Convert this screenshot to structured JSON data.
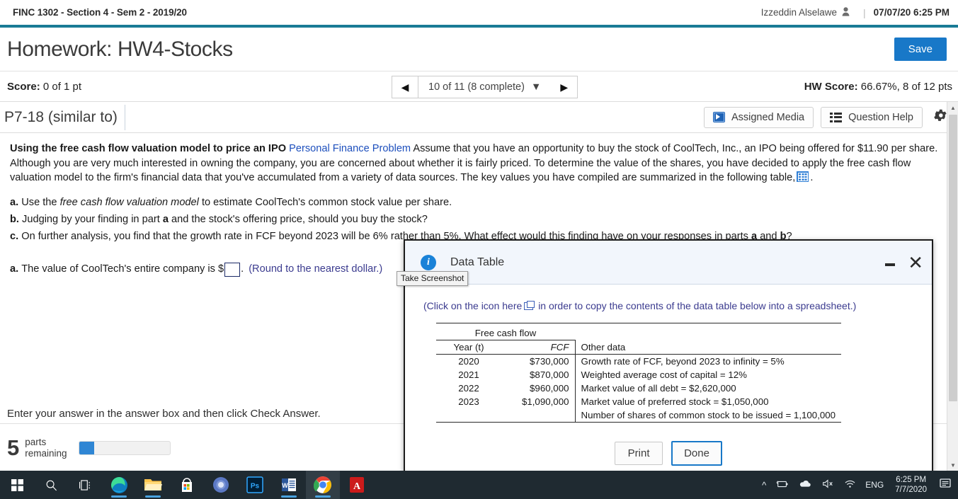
{
  "topbar": {
    "course": "FINC 1302 - Section 4 - Sem 2 - 2019/20",
    "user": "Izzeddin Alselawe",
    "separator": "|",
    "datetime": "07/07/20 6:25 PM",
    "person_icon": "person-icon"
  },
  "header": {
    "title": "Homework: HW4-Stocks",
    "save_label": "Save"
  },
  "scorebar": {
    "score_label": "Score:",
    "score_value": "0 of 1 pt",
    "prev_icon": "◀",
    "next_icon": "▶",
    "nav_label": "10 of 11 (8 complete)",
    "nav_caret": "▼",
    "hw_score_label": "HW Score:",
    "hw_score_value": "66.67%, 8 of 12 pts"
  },
  "exercise": {
    "id": "P7-18 (similar to)",
    "assigned_media": "Assigned Media",
    "question_help": "Question Help"
  },
  "question": {
    "bold_lead": "Using the free cash flow valuation model to price an IPO",
    "link": "Personal Finance Problem",
    "para": "Assume that you have an opportunity to buy the stock of CoolTech, Inc., an IPO being offered for $11.90 per share. Although you are very much interested in owning the company, you are concerned about whether it is fairly priced.  To determine the value of the shares, you have decided to apply the free cash flow valuation model to the firm's financial data that you've accumulated from a variety of data sources.  The key values you have compiled are summarized in the following table,",
    "para_end": ".",
    "parts": [
      {
        "label": "a.",
        "pre": "Use the ",
        "italic": "free cash flow valuation model",
        "post": " to estimate CoolTech's common stock value per share."
      },
      {
        "label": "b.",
        "pre": "Judging by your finding in part ",
        "italic": "",
        "post": "a and the stock's offering price, should you buy the stock?"
      },
      {
        "label": "c.",
        "pre": "On further analysis, you find that the growth rate in FCF beyond 2023 will be 6% rather than 5%. What effect would this finding have on your responses in parts ",
        "italic": "",
        "post": "a and b?"
      }
    ],
    "answer": {
      "label": "a.",
      "text": "The value of CoolTech's entire company is $",
      "value": "",
      "suffix": ".",
      "note": "(Round to the nearest dollar.)"
    }
  },
  "footer": {
    "prompt": "Enter your answer in the answer box and then click Check Answer.",
    "parts_number": "5",
    "parts_word1": "parts",
    "parts_word2": "remaining",
    "progress_percent": 17
  },
  "dialog": {
    "title": "Data Table",
    "info_icon": "i",
    "tooltip": "Take Screenshot",
    "minimize_icon": "minimize-icon",
    "close_icon": "✕",
    "copy_note_pre": "(Click on the icon here",
    "copy_note_post": "in order to copy the contents of the data table below into a spreadsheet.)",
    "group_header": "Free cash flow",
    "col_year": "Year (t)",
    "col_fcf": "FCF",
    "col_other": "Other data",
    "rows": [
      {
        "year": "2020",
        "fcf": "$730,000",
        "other": "Growth rate of FCF, beyond 2023 to infinity = 5%"
      },
      {
        "year": "2021",
        "fcf": "$870,000",
        "other": "Weighted average cost of capital = 12%"
      },
      {
        "year": "2022",
        "fcf": "$960,000",
        "other": "Market value of all debt = $2,620,000"
      },
      {
        "year": "2023",
        "fcf": "$1,090,000",
        "other": "Market value of preferred stock = $1,050,000"
      },
      {
        "year": "",
        "fcf": "",
        "other": "Number of shares of common stock to be issued = 1,100,000"
      }
    ],
    "print_label": "Print",
    "done_label": "Done"
  },
  "taskbar": {
    "language": "ENG",
    "time": "6:25 PM",
    "date": "7/7/2020",
    "items": [
      {
        "name": "start-button",
        "glyph": "⊞"
      },
      {
        "name": "search-icon",
        "glyph": "⚲"
      },
      {
        "name": "task-view-icon",
        "glyph": "▤"
      },
      {
        "name": "edge-icon",
        "glyph": "e"
      },
      {
        "name": "file-explorer-icon",
        "glyph": "🗀"
      },
      {
        "name": "microsoft-store-icon",
        "glyph": "⊞"
      },
      {
        "name": "chromium-icon",
        "glyph": "●"
      },
      {
        "name": "photoshop-icon",
        "glyph": "Ps"
      },
      {
        "name": "word-icon",
        "glyph": "W"
      },
      {
        "name": "chrome-icon",
        "glyph": "●"
      },
      {
        "name": "acrobat-icon",
        "glyph": "A"
      }
    ],
    "tray": [
      {
        "name": "show-hidden-icons",
        "glyph": "∧"
      },
      {
        "name": "battery-icon",
        "glyph": "▬"
      },
      {
        "name": "onedrive-icon",
        "glyph": "☁"
      },
      {
        "name": "volume-muted-icon",
        "glyph": "🔇"
      },
      {
        "name": "wifi-icon",
        "glyph": "◠"
      }
    ],
    "action_center_icon": "⌲"
  },
  "colors": {
    "teal": "#197b96",
    "blue": "#1878c8",
    "link": "#1d4fbd"
  }
}
